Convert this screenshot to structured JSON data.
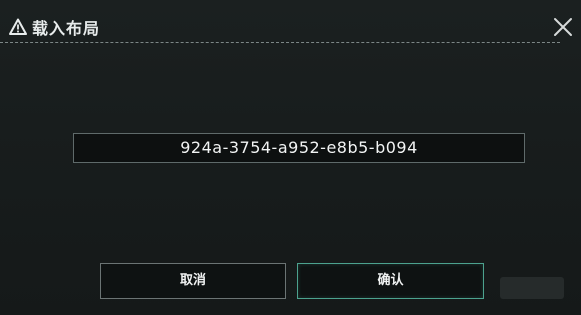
{
  "dialog": {
    "title": "载入布局",
    "title_icon": "warning-triangle-icon",
    "close_icon": "close-icon",
    "layout_id": "924a-3754-a952-e8b5-b094",
    "cancel_label": "取消",
    "confirm_label": "确认"
  },
  "colors": {
    "background": "#181d1d",
    "confirm_border": "#4ca28e",
    "cancel_border": "#6b7474"
  }
}
